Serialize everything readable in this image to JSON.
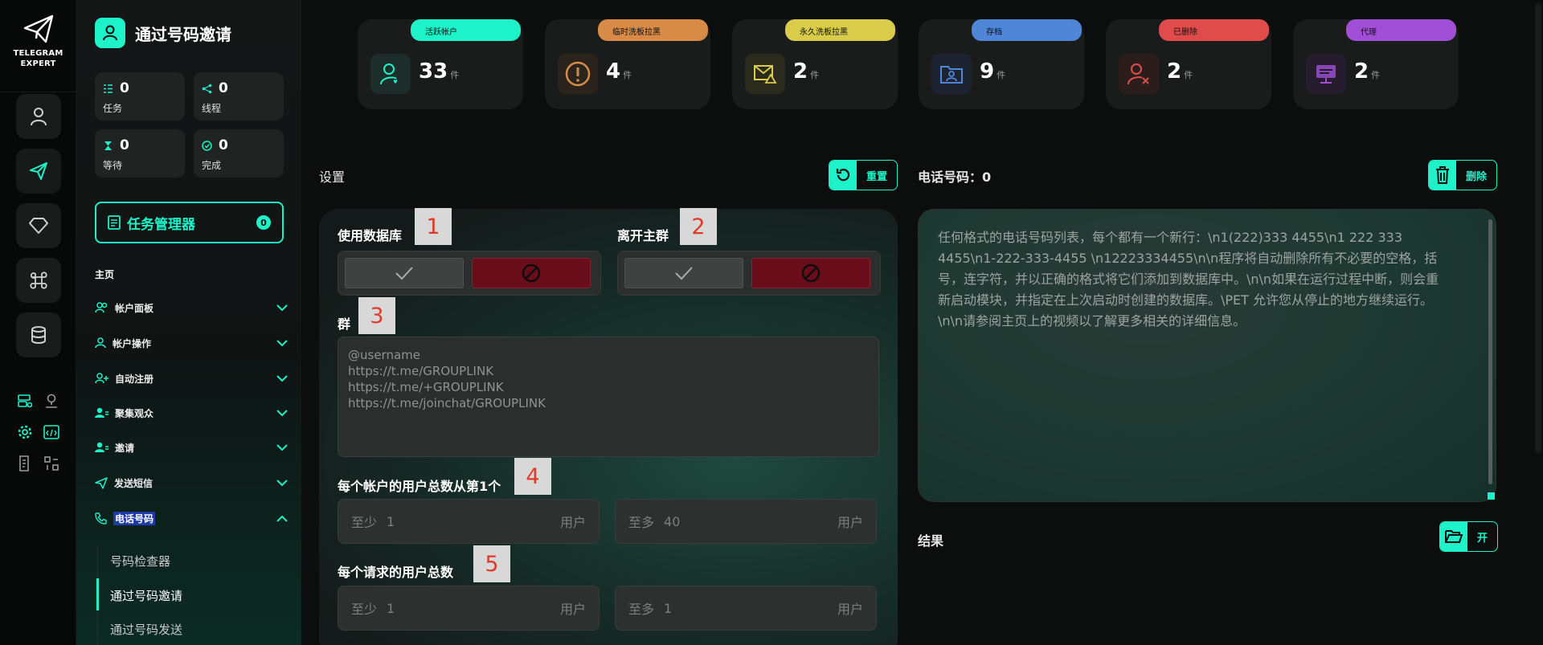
{
  "app": {
    "logo_line1": "TELEGRAM",
    "logo_line2": "EXPERT"
  },
  "sidebar": {
    "title": "通过号码邀请",
    "stats": [
      {
        "value": "0",
        "label": "任务"
      },
      {
        "value": "0",
        "label": "线程"
      },
      {
        "value": "0",
        "label": "等待"
      },
      {
        "value": "0",
        "label": "完成"
      }
    ],
    "task_manager": {
      "label": "任务管理器",
      "count": "0"
    },
    "section_label": "主页",
    "nav": [
      {
        "label": "帐户面板"
      },
      {
        "label": "帐户操作"
      },
      {
        "label": "自动注册"
      },
      {
        "label": "聚集观众"
      },
      {
        "label": "邀请"
      },
      {
        "label": "发送短信"
      },
      {
        "label": "电话号码"
      }
    ],
    "sub_items": [
      {
        "label": "号码检查器"
      },
      {
        "label": "通过号码邀请"
      },
      {
        "label": "通过号码发送"
      }
    ]
  },
  "status_cards": [
    {
      "tab": "活跃帐户",
      "count": "33",
      "unit": "件",
      "color": "#1ef2c8"
    },
    {
      "tab": "临时洗板拉黑",
      "count": "4",
      "unit": "件",
      "color": "#d88a47"
    },
    {
      "tab": "永久洗板拉黑",
      "count": "2",
      "unit": "件",
      "color": "#d8cc4a"
    },
    {
      "tab": "存档",
      "count": "9",
      "unit": "件",
      "color": "#4f86d8"
    },
    {
      "tab": "已删除",
      "count": "2",
      "unit": "件",
      "color": "#e04b4b"
    },
    {
      "tab": "代理",
      "count": "2",
      "unit": "件",
      "color": "#a24fd8"
    }
  ],
  "settings": {
    "heading": "设置",
    "reset_label": "重置",
    "use_database_label": "使用数据库",
    "leave_group_label": "离开主群",
    "group_label": "群",
    "group_placeholder": "@username\nhttps://t.me/GROUPLINK\nhttps://t.me/+GROUPLINK\nhttps://t.me/joinchat/GROUPLINK",
    "per_account_label": "每个帐户的用户总数从第1个",
    "per_request_label": "每个请求的用户总数",
    "per_account_min": {
      "prefix": "至少",
      "value": "1",
      "suffix": "用户"
    },
    "per_account_max": {
      "prefix": "至多",
      "value": "40",
      "suffix": "用户"
    },
    "per_request_min": {
      "prefix": "至少",
      "value": "1",
      "suffix": "用户"
    },
    "per_request_max": {
      "prefix": "至多",
      "value": "1",
      "suffix": "用户"
    },
    "tags": [
      "1",
      "2",
      "3",
      "4",
      "5"
    ]
  },
  "phone": {
    "heading": "电话号码：0",
    "delete_label": "删除",
    "placeholder": "任何格式的电话号码列表，每个都有一个新行：\\n1(222)333 4455\\n1 222 333 4455\\n1-222-333-4455 \\n12223334455\\n\\n程序将自动删除所有不必要的空格，括号，连字符，并以正确的格式将它们添加到数据库中。\\n\\n如果在运行过程中断，则会重新启动模块，并指定在上次启动时创建的数据库。\\PET 允许您从停止的地方继续运行。\\n\\n请参阅主页上的视频以了解更多相关的详细信息。"
  },
  "result": {
    "heading": "结果",
    "open_label": "开"
  },
  "colors": {
    "accent": "#1ef2c8",
    "deny": "#6a0d1a"
  }
}
